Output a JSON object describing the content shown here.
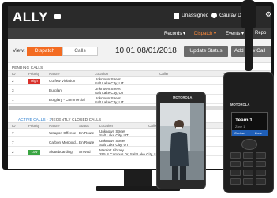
{
  "app": {
    "name": "ALLY"
  },
  "header": {
    "status": "Unassigned",
    "user": "Gaurav Doshi"
  },
  "menu": [
    {
      "label": "Records",
      "active": false
    },
    {
      "label": "Dispatch",
      "active": true
    },
    {
      "label": "Events",
      "active": false
    },
    {
      "label": "Repo",
      "active": false
    }
  ],
  "view": {
    "label": "View:",
    "tabs": [
      "Dispatch",
      "Calls"
    ],
    "clock": "10:01 08/01/2018",
    "update_status": "Update Status",
    "add_new": "Add New Call"
  },
  "pending": {
    "title": "PENDING CALLS",
    "columns": [
      "ID",
      "Priority",
      "Nature",
      "Location",
      "Caller",
      "Area",
      "Time"
    ],
    "rows": [
      {
        "id": "2",
        "priority": "High",
        "nature": "Curfew Violation",
        "loc1": "Unknown Street",
        "loc2": "Salt Lake City, UT"
      },
      {
        "id": "3",
        "priority": "",
        "nature": "Burglary",
        "loc1": "Unknown Street",
        "loc2": "Salt Lake City, UT"
      },
      {
        "id": "1",
        "priority": "",
        "nature": "Burglary - Commercial",
        "loc1": "Unknown Street",
        "loc2": "Salt Lake City, UT"
      }
    ]
  },
  "active": {
    "title": "ACTIVE CALLS · 3",
    "recent_title": "RECENTLY CLOSED CALLS",
    "columns": [
      "ID",
      "Priority",
      "Nature",
      "Status",
      "Location",
      "Caller"
    ],
    "rows": [
      {
        "id": "7",
        "priority": "",
        "nature": "Weapon Offense",
        "status": "En Route",
        "loc1": "Unknown Street",
        "loc2": "Salt Lake City, UT"
      },
      {
        "id": "7",
        "priority": "",
        "nature": "Carbon Monoxid...",
        "status": "En Route",
        "loc1": "Unknown Street",
        "loc2": "Salt Lake City, UT"
      },
      {
        "id": "2",
        "priority": "Low",
        "nature": "Skateboarding",
        "status": "Arrived",
        "loc1": "Marriott Library",
        "loc2": "295 S Campus Dr, Salt Lake City, UT"
      }
    ]
  },
  "phone": {
    "brand": "MOTOROLA"
  },
  "radio": {
    "brand": "MOTOROLA",
    "display_title": "Team 1",
    "display_sub": "Zone 1",
    "soft_left": "Contact",
    "soft_right": "Zone"
  },
  "colors": {
    "accent": "#f36b21",
    "priority_high": "#d9302a",
    "priority_low": "#3aa542",
    "link": "#1a73c9"
  },
  "icons": [
    "mail-icon",
    "document-icon",
    "user-icon",
    "gear-icon"
  ]
}
